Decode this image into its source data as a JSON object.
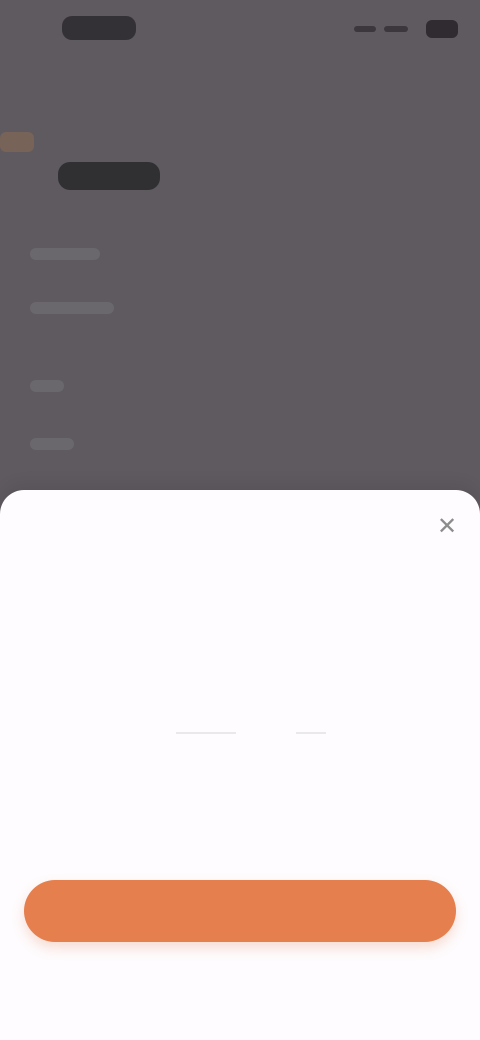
{
  "status_bar": {
    "time": "",
    "icons": [
      "signal-icon",
      "wifi-icon",
      "battery-icon"
    ]
  },
  "background_screen": {
    "title": "",
    "rows": [
      "",
      "",
      "",
      "",
      ""
    ]
  },
  "bottom_sheet": {
    "close_label": "✕",
    "pickers": [
      {
        "top_label": "",
        "value": "",
        "bottom_label": ""
      },
      {
        "top_label": "",
        "value": "",
        "bottom_label": ""
      },
      {
        "top_label": "",
        "value": "",
        "bottom_label": ""
      }
    ],
    "primary_button_label": ""
  },
  "colors": {
    "overlay": "#5f5a60",
    "sheet": "#fefcfe",
    "accent": "#e57f4e"
  }
}
